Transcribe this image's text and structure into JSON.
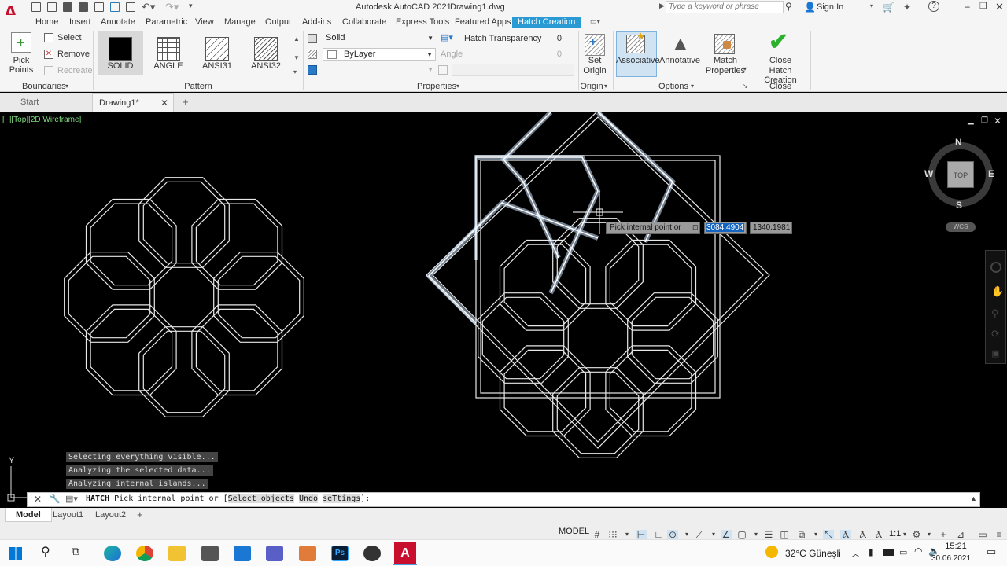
{
  "titlebar": {
    "app_title": "Autodesk AutoCAD 2021",
    "doc_name": "Drawing1.dwg",
    "search_placeholder": "Type a keyword or phrase",
    "sign_in": "Sign In"
  },
  "menu": [
    "Home",
    "Insert",
    "Annotate",
    "Parametric",
    "View",
    "Manage",
    "Output",
    "Add-ins",
    "Collaborate",
    "Express Tools",
    "Featured Apps",
    "Hatch Creation"
  ],
  "ribbon": {
    "boundaries": {
      "pick_points": "Pick Points",
      "select": "Select",
      "remove": "Remove",
      "recreate": "Recreate",
      "title": "Boundaries"
    },
    "pattern": {
      "items": [
        "SOLID",
        "ANGLE",
        "ANSI31",
        "ANSI32"
      ],
      "title": "Pattern"
    },
    "properties": {
      "type": "Solid",
      "color": "ByLayer",
      "transparency_label": "Hatch Transparency",
      "transparency_value": "0",
      "angle_label": "Angle",
      "angle_value": "0",
      "title": "Properties"
    },
    "origin": {
      "set_origin_1": "Set",
      "set_origin_2": "Origin",
      "title": "Origin"
    },
    "options": {
      "associative": "Associative",
      "annotative": "Annotative",
      "match_1": "Match",
      "match_2": "Properties",
      "title": "Options"
    },
    "close": {
      "close_1": "Close",
      "close_2": "Hatch Creation",
      "title": "Close"
    }
  },
  "doctabs": {
    "start": "Start",
    "drawing": "Drawing1*"
  },
  "viewport": {
    "label": "[−][Top][2D Wireframe]",
    "compass": {
      "n": "N",
      "s": "S",
      "e": "E",
      "w": "W",
      "top": "TOP"
    },
    "wcs": "WCS"
  },
  "tooltip": {
    "prompt": "Pick internal point or",
    "x": "3084.4904",
    "y": "1340.1981"
  },
  "history": [
    "Selecting everything visible...",
    "Analyzing the selected data...",
    "Analyzing internal islands..."
  ],
  "command": {
    "name": "HATCH",
    "prompt": "Pick internal point or [",
    "opt1": "Select objects",
    "opt2": "Undo",
    "opt3": "seTtings",
    "end": "]:"
  },
  "layouts": [
    "Model",
    "Layout1",
    "Layout2"
  ],
  "status": {
    "model": "MODEL",
    "scale": "1:1"
  },
  "taskbar": {
    "weather": "32°C Güneşli",
    "time": "15:21",
    "date": "30.06.2021"
  }
}
